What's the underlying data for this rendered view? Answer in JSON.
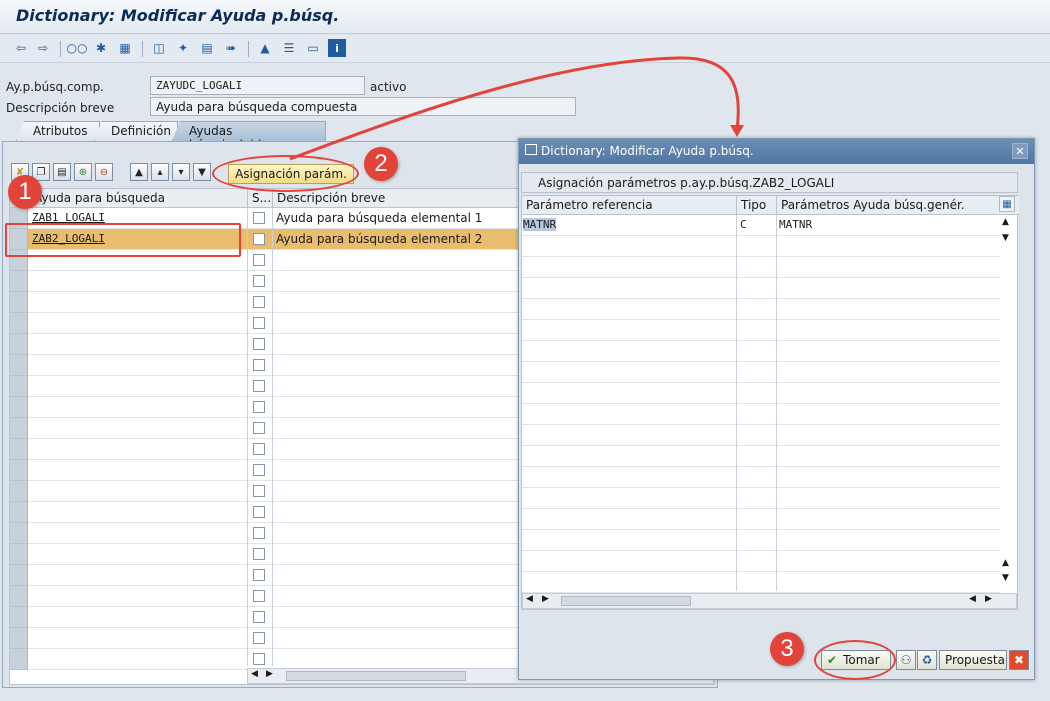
{
  "window": {
    "title": "Dictionary: Modificar Ayuda p.búsq."
  },
  "toolbar": {
    "icons": [
      "back-arrow-icon",
      "forward-arrow-icon",
      "glasses-edit-icon",
      "activate-icon",
      "object-list-icon",
      "hierarchy-icon",
      "magic-wand-icon",
      "where-used-icon",
      "transport-icon",
      "tree-icon",
      "align-icon",
      "display-icon",
      "info-icon"
    ]
  },
  "header": {
    "searchhelp_label": "Ay.p.búsq.comp.",
    "searchhelp_value": "ZAYUDC_LOGALI",
    "status": "activo",
    "desc_label": "Descripción breve",
    "desc_value": "Ayuda para búsqueda compuesta"
  },
  "tabs": [
    {
      "label": "Atributos"
    },
    {
      "label": "Definición"
    },
    {
      "label": "Ayudas búsq.incluidas"
    }
  ],
  "included": {
    "param_button": "Asignación parám.",
    "columns": {
      "searchhelp": "Ayuda para búsqueda",
      "s": "S...",
      "desc": "Descripción breve"
    },
    "rows": [
      {
        "name": "ZAB1_LOGALI",
        "desc": "Ayuda para búsqueda elemental 1"
      },
      {
        "name": "ZAB2_LOGALI",
        "desc": "Ayuda para búsqueda elemental 2"
      }
    ]
  },
  "dialog": {
    "title": "Dictionary: Modificar Ayuda p.búsq.",
    "section": "Asignación parámetros p.ay.p.búsq.ZAB2_LOGALI",
    "columns": {
      "ref": "Parámetro referencia",
      "tipo": "Tipo",
      "gen": "Parámetros Ayuda búsq.genér."
    },
    "rows": [
      {
        "ref": "MATNR",
        "tipo": "C",
        "gen": "MATNR"
      }
    ],
    "take_button": "Tomar",
    "proposal_button": "Propuesta"
  },
  "annotations": {
    "step1": "1",
    "step2": "2",
    "step3": "3"
  },
  "colors": {
    "highlight_row": "#e8be6e",
    "callout": "#e2443a",
    "title_bar": "#4f76a2"
  }
}
